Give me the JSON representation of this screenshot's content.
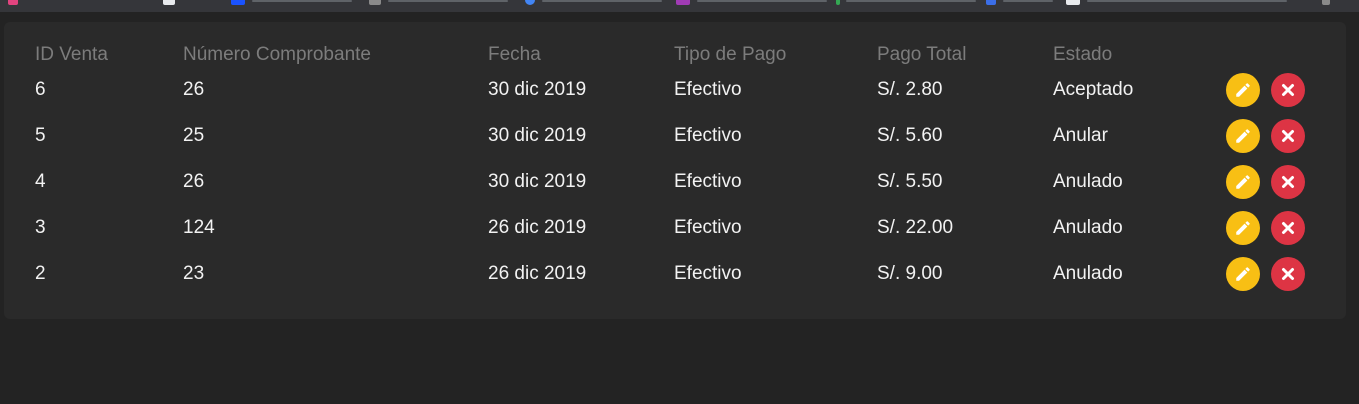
{
  "table": {
    "headers": [
      "ID Venta",
      "Número Comprobante",
      "Fecha",
      "Tipo de Pago",
      "Pago Total",
      "Estado"
    ],
    "rows": [
      {
        "id": "6",
        "numero": "26",
        "fecha": "30 dic 2019",
        "tipo": "Efectivo",
        "pago": "S/. 2.80",
        "estado": "Aceptado"
      },
      {
        "id": "5",
        "numero": "25",
        "fecha": "30 dic 2019",
        "tipo": "Efectivo",
        "pago": "S/. 5.60",
        "estado": "Anular"
      },
      {
        "id": "4",
        "numero": "26",
        "fecha": "30 dic 2019",
        "tipo": "Efectivo",
        "pago": "S/. 5.50",
        "estado": "Anulado"
      },
      {
        "id": "3",
        "numero": "124",
        "fecha": "26 dic 2019",
        "tipo": "Efectivo",
        "pago": "S/. 22.00",
        "estado": "Anulado"
      },
      {
        "id": "2",
        "numero": "23",
        "fecha": "26 dic 2019",
        "tipo": "Efectivo",
        "pago": "S/. 9.00",
        "estado": "Anulado"
      }
    ]
  },
  "actions": {
    "edit_icon": "pencil-icon",
    "delete_icon": "close-icon",
    "edit_color": "#f8bf14",
    "delete_color": "#dd3444"
  }
}
